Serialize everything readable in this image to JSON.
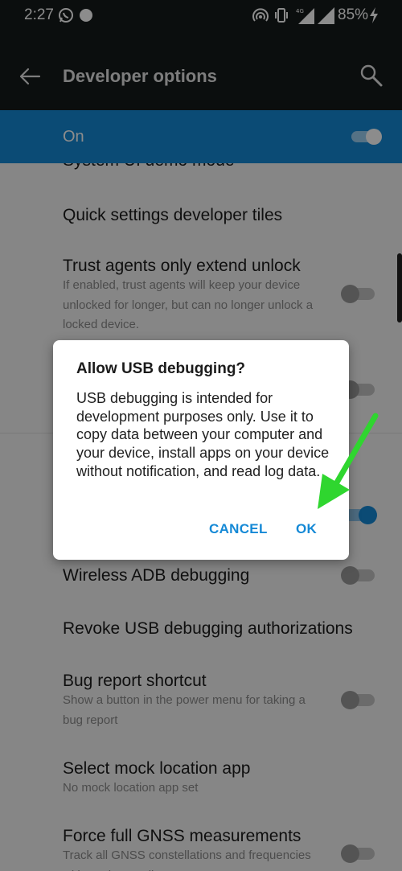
{
  "status_bar": {
    "time": "2:27",
    "battery": "85%",
    "icons": [
      "whatsapp-icon",
      "notification-dot-icon",
      "hotspot-icon",
      "vibrate-icon",
      "signal-4g-icon",
      "signal-icon",
      "charging-bolt-icon"
    ]
  },
  "app_bar": {
    "title": "Developer options",
    "back_icon": "arrow-back-icon",
    "search_icon": "search-icon"
  },
  "master_switch": {
    "label": "On",
    "state": "on"
  },
  "settings": {
    "partial_item_title": "System UI demo mode",
    "items": [
      {
        "title": "Quick settings developer tiles"
      },
      {
        "title": "Trust agents only extend unlock",
        "subtitle": "If enabled, trust agents will keep your device unlocked for longer, but can no longer unlock a locked device.",
        "toggle": "off"
      },
      {
        "title": "",
        "toggle": "off"
      },
      {
        "title": "",
        "toggle": "on"
      },
      {
        "title": "Wireless ADB debugging",
        "toggle": "off"
      },
      {
        "title": "Revoke USB debugging authorizations"
      },
      {
        "title": "Bug report shortcut",
        "subtitle": "Show a button in the power menu for taking a bug report",
        "toggle": "off"
      },
      {
        "title": "Select mock location app",
        "subtitle": "No mock location app set"
      },
      {
        "title": "Force full GNSS measurements",
        "subtitle": "Track all GNSS constellations and frequencies with no duty cycling",
        "toggle": "off"
      }
    ]
  },
  "dialog": {
    "title": "Allow USB debugging?",
    "message": "USB debugging is intended for development purposes only. Use it to copy data between your computer and your device, install apps on your device without notification, and read log data.",
    "cancel_label": "CANCEL",
    "ok_label": "OK"
  },
  "colors": {
    "accent": "#1589d6",
    "toolbar": "#151a1b",
    "annotation_arrow": "#2fd62f"
  }
}
